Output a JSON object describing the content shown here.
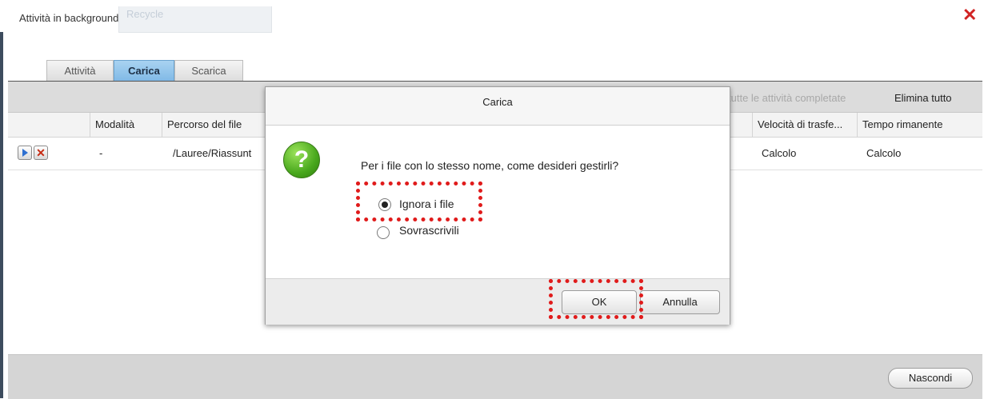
{
  "window": {
    "title": "Attività in background",
    "ghost_tab_text": "Recycle",
    "close_label": "✕"
  },
  "tabs": [
    {
      "label": "Attività",
      "active": false
    },
    {
      "label": "Carica",
      "active": true
    },
    {
      "label": "Scarica",
      "active": false
    }
  ],
  "toolbar": {
    "clear_completed_label": "tutte le attività completate",
    "delete_all_label": "Elimina tutto"
  },
  "columns": [
    "Modalità",
    "Percorso del file",
    "Velocità di trasfe...",
    "Tempo rimanente"
  ],
  "rows": [
    {
      "mode": "-",
      "path": "/Lauree/Riassunt",
      "speed": "Calcolo",
      "remaining": "Calcolo"
    }
  ],
  "footer": {
    "hide_label": "Nascondi"
  },
  "dialog": {
    "title": "Carica",
    "question": "Per i file con lo stesso nome, come desideri gestirli?",
    "options": [
      {
        "label": "Ignora i file",
        "selected": true
      },
      {
        "label": "Sovrascrivili",
        "selected": false
      }
    ],
    "ok_label": "OK",
    "cancel_label": "Annulla"
  },
  "colors": {
    "accent_tab": "#7fb8e6",
    "close": "#d12424",
    "highlight": "#e01b1b",
    "question_icon": "#49a81d"
  },
  "icons": [
    "close-icon",
    "play-icon",
    "cancel-icon",
    "question-icon"
  ]
}
